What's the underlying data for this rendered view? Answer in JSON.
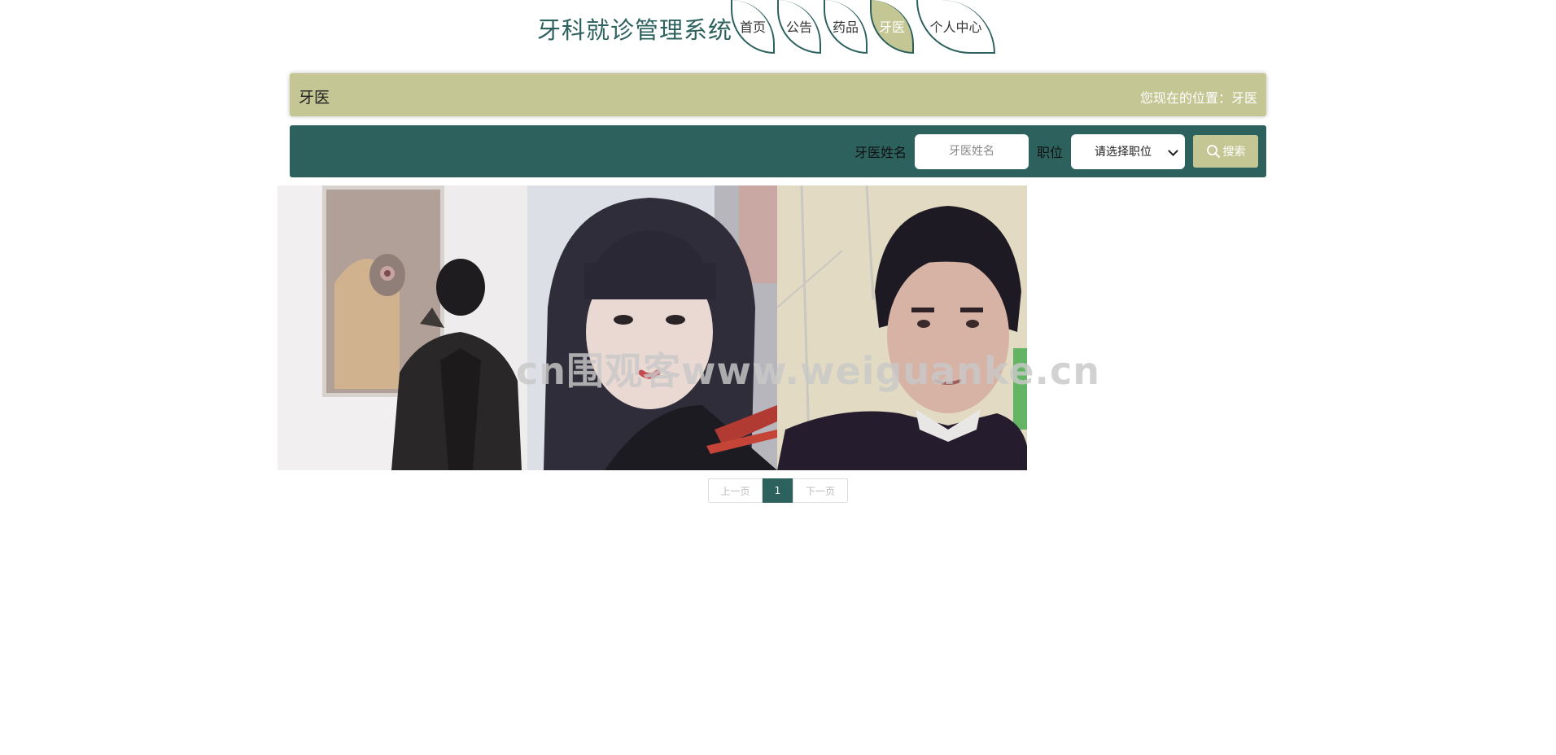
{
  "header": {
    "site_title": "牙科就诊管理系统",
    "nav": [
      {
        "label": "首页"
      },
      {
        "label": "公告"
      },
      {
        "label": "药品"
      },
      {
        "label": "牙医"
      },
      {
        "label": "个人中心"
      }
    ],
    "active_nav": "牙医"
  },
  "breadcrumb": {
    "title": "牙医",
    "path": "您现在的位置：牙医"
  },
  "search": {
    "name_label": "牙医姓名",
    "name_placeholder": "牙医姓名",
    "name_value": "",
    "position_label": "职位",
    "position_selected": "请选择职位",
    "button_label": "搜索"
  },
  "gallery": {
    "items": [
      {
        "icon": "dentist-photo-1"
      },
      {
        "icon": "dentist-photo-2"
      },
      {
        "icon": "dentist-photo-3"
      }
    ]
  },
  "watermark": "cn围观客www.weiguanke.cn",
  "pagination": {
    "prev": "上一页",
    "current": "1",
    "next": "下一页"
  },
  "colors": {
    "primary": "#2d615e",
    "accent": "#c4c694",
    "background": "#ffffff"
  }
}
